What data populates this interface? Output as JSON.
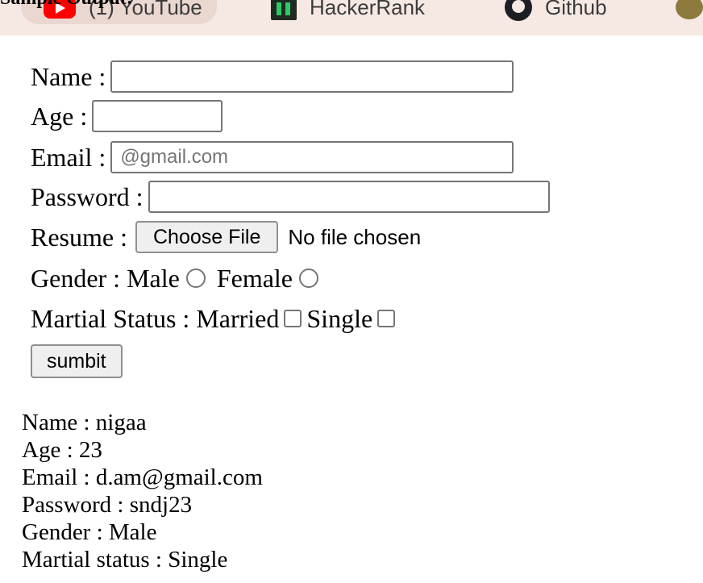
{
  "heading": "Sample Output:",
  "bookmarks": [
    {
      "label": "(1) YouTube",
      "icon": "youtube-icon"
    },
    {
      "label": "HackerRank",
      "icon": "hackerrank-icon"
    },
    {
      "label": "Github",
      "icon": "github-icon"
    }
  ],
  "form": {
    "name_label": "Name :",
    "name_value": "",
    "age_label": "Age :",
    "age_value": "",
    "email_label": "Email :",
    "email_placeholder": "@gmail.com",
    "password_label": "Password :",
    "password_value": "",
    "resume_label": "Resume :",
    "choose_file_label": "Choose File",
    "file_status": "No file chosen",
    "gender_label": "Gender :",
    "gender_male": "Male",
    "gender_female": "Female",
    "marital_label": "Martial Status :",
    "marital_married": "Married",
    "marital_single": "Single",
    "submit_label": "sumbit"
  },
  "output": {
    "lines": [
      "Name : nigaa",
      "Age : 23",
      "Email : d.am@gmail.com",
      "Password : sndj23",
      "Gender : Male",
      "Martial status : Single"
    ]
  },
  "colors": {
    "bookmarks_bar_bg": "#f6e9e4",
    "youtube_red": "#ff0000",
    "hackerrank_green": "#2ec866"
  }
}
